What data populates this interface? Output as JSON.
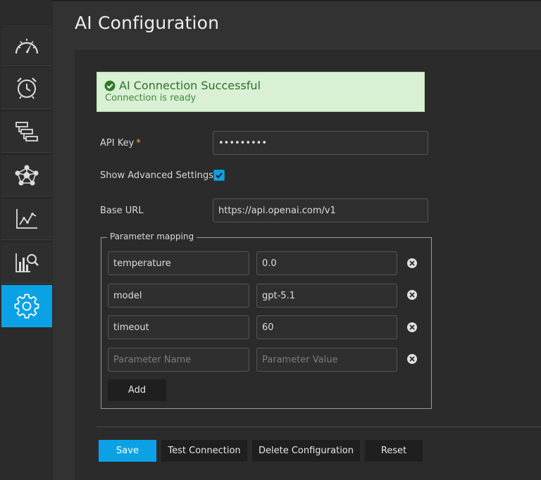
{
  "page": {
    "title": "AI Configuration"
  },
  "sidebar": {
    "items": [
      {
        "icon": "gauge-icon",
        "active": false
      },
      {
        "icon": "alarm-clock-icon",
        "active": false
      },
      {
        "icon": "flow-blocks-icon",
        "active": false
      },
      {
        "icon": "network-star-icon",
        "active": false
      },
      {
        "icon": "line-chart-icon",
        "active": false
      },
      {
        "icon": "chart-search-icon",
        "active": false
      },
      {
        "icon": "gear-icon",
        "active": true
      }
    ]
  },
  "alert": {
    "title": "AI Connection Successful",
    "subtitle": "Connection is ready",
    "icon": "check-circle-icon"
  },
  "form": {
    "api_key_label": "API Key",
    "api_key_required": "*",
    "api_key_value": "•••••••••",
    "advanced_label": "Show Advanced Settings",
    "advanced_checked": true,
    "base_url_label": "Base URL",
    "base_url_value": "https://api.openai.com/v1"
  },
  "params": {
    "legend": "Parameter mapping",
    "rows": [
      {
        "name": "temperature",
        "value": "0.0"
      },
      {
        "name": "model",
        "value": "gpt-5.1"
      },
      {
        "name": "timeout",
        "value": "60"
      }
    ],
    "new_name_placeholder": "Parameter Name",
    "new_value_placeholder": "Parameter Value",
    "add_label": "Add"
  },
  "actions": {
    "save": "Save",
    "test": "Test Connection",
    "delete": "Delete Configuration",
    "reset": "Reset"
  },
  "colors": {
    "accent": "#0aa2e4",
    "success_bg": "#d9f0d5",
    "success_text": "#2f6f2a",
    "required": "#f0b429"
  }
}
